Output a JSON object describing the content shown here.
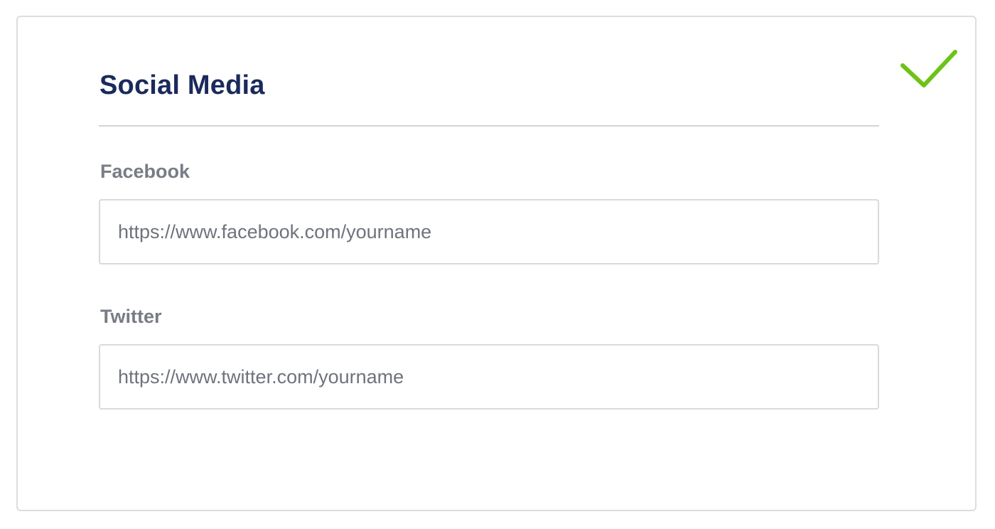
{
  "section": {
    "title": "Social Media"
  },
  "status": {
    "icon": "checkmark-icon",
    "color": "#6cc317"
  },
  "fields": {
    "facebook": {
      "label": "Facebook",
      "value": "",
      "placeholder": "https://www.facebook.com/yourname"
    },
    "twitter": {
      "label": "Twitter",
      "value": "",
      "placeholder": "https://www.twitter.com/yourname"
    }
  }
}
